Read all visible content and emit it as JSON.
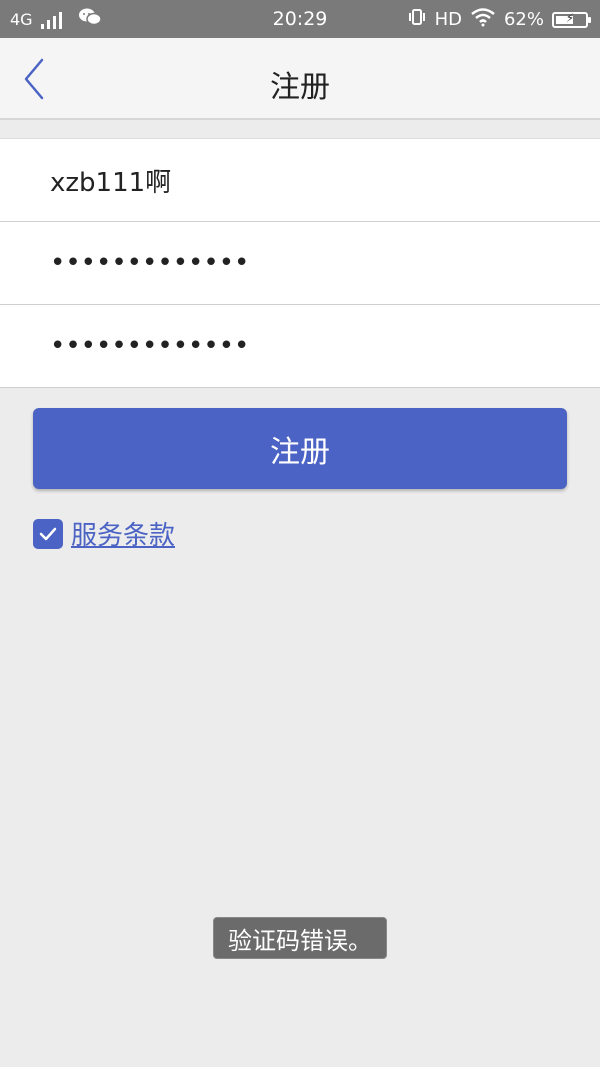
{
  "status_bar": {
    "network": "4G",
    "time": "20:29",
    "hd": "HD",
    "battery": "62%",
    "battery_level": 0.62,
    "icons": [
      "signal-icon",
      "wechat-icon",
      "vibrate-icon",
      "wifi-icon",
      "battery-icon"
    ]
  },
  "header": {
    "title": "注册",
    "back_icon": "chevron-left-icon"
  },
  "form": {
    "username_value": "xzb111啊",
    "password_value": "•••••••••••••",
    "confirm_password_value": "•••••••••••••"
  },
  "register_button": {
    "label": "注册"
  },
  "terms": {
    "checked": true,
    "label": "服务条款"
  },
  "toast": {
    "message": "验证码错误。"
  },
  "colors": {
    "accent": "#4b63c4",
    "background": "#ececec",
    "status_bar": "#7a7a7a",
    "toast": "#6b6b6b"
  }
}
